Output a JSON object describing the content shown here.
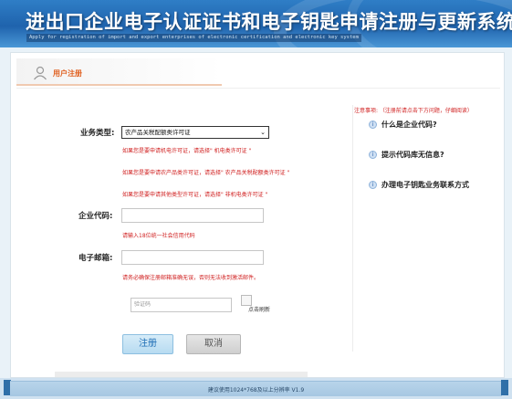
{
  "header": {
    "title": "进出口企业电子认证证书和电子钥匙申请注册与更新系统",
    "subtitle": "Apply for registration of import and export enterprises of electronic certification and electronic key system"
  },
  "tab": {
    "label": "用户注册",
    "icon": "user-icon"
  },
  "form": {
    "business_type": {
      "label": "业务类型:",
      "selected": "农产品关税配额类许可证",
      "hints": [
        "如果您是要申请机电许可证，请选择\" 机电类许可证 \"",
        "如果您是要申请农产品类许可证，请选择\" 农产品关税配额类许可证 \"",
        "如果您是要申请其他类型许可证，请选择\" 非机电类许可证 \""
      ]
    },
    "company_code": {
      "label": "企业代码:",
      "value": "",
      "hint": "请输入18位统一社会信用代码"
    },
    "email": {
      "label": "电子邮箱:",
      "value": "",
      "hint": "请务必确保注册邮箱准确无误，否则无法收到激活邮件。"
    },
    "captcha": {
      "placeholder": "验证码",
      "refresh_label": "点击刷新"
    },
    "buttons": {
      "register": "注册",
      "cancel": "取消"
    }
  },
  "help": {
    "notice": "注意事项: （注册前请点击下方问题，仔细阅读）",
    "items": [
      {
        "label": "什么是企业代码?",
        "icon": "info-icon"
      },
      {
        "label": "提示代码库无信息?",
        "icon": "info-icon"
      },
      {
        "label": "办理电子钥匙业务联系方式",
        "icon": "info-icon"
      }
    ]
  },
  "footer": {
    "text": "建议使用1024*768及以上分辨率 V1.9"
  },
  "colors": {
    "header_blue": "#1f63ad",
    "accent_orange": "#e06020",
    "hint_red": "#d02020",
    "register_blue": "#b7dbf1"
  }
}
